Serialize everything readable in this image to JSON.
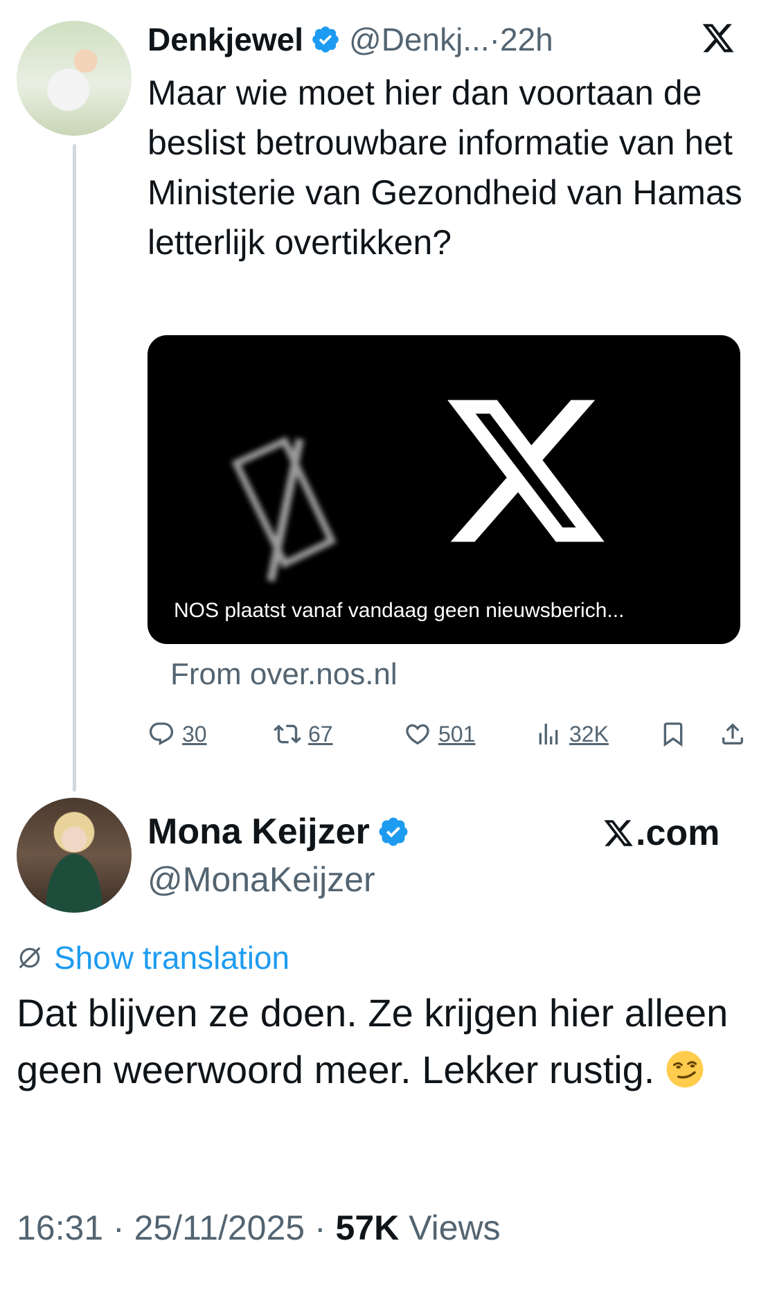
{
  "parent_tweet": {
    "author_name": "Denkjewel",
    "author_handle": "@Denkj...",
    "separator": "·",
    "time": "22h",
    "text": "Maar wie moet hier dan voortaan de beslist betrouwbare informatie van het Ministerie van Gezondheid van Hamas letterlijk overtikken?",
    "card": {
      "caption": "NOS plaatst vanaf vandaag geen nieuwsberich...",
      "source": "From over.nos.nl"
    },
    "actions": {
      "replies": "30",
      "reposts": "67",
      "likes": "501",
      "views": "32K"
    }
  },
  "reply_tweet": {
    "author_name": "Mona Keijzer",
    "author_handle": "@MonaKeijzer",
    "brand_suffix": ".com",
    "show_translation": "Show translation",
    "text": "Dat blijven ze doen. Ze krijgen hier alleen geen weerwoord meer. Lekker rustig.",
    "footer": {
      "time": "16:31",
      "separator_1": " · ",
      "date": "25/11/2025",
      "separator_2": " · ",
      "views_count": "57K",
      "views_label": " Views"
    }
  },
  "colors": {
    "verified_blue": "#1d9bf0",
    "secondary_text": "#536471",
    "primary_text": "#0f1419",
    "link_blue": "#1d9bf0"
  },
  "icons": [
    "verified-badge-icon",
    "x-logo-icon",
    "reply-icon",
    "repost-icon",
    "like-icon",
    "views-icon",
    "bookmark-icon",
    "share-icon",
    "translation-icon",
    "smirk-emoji-icon"
  ]
}
